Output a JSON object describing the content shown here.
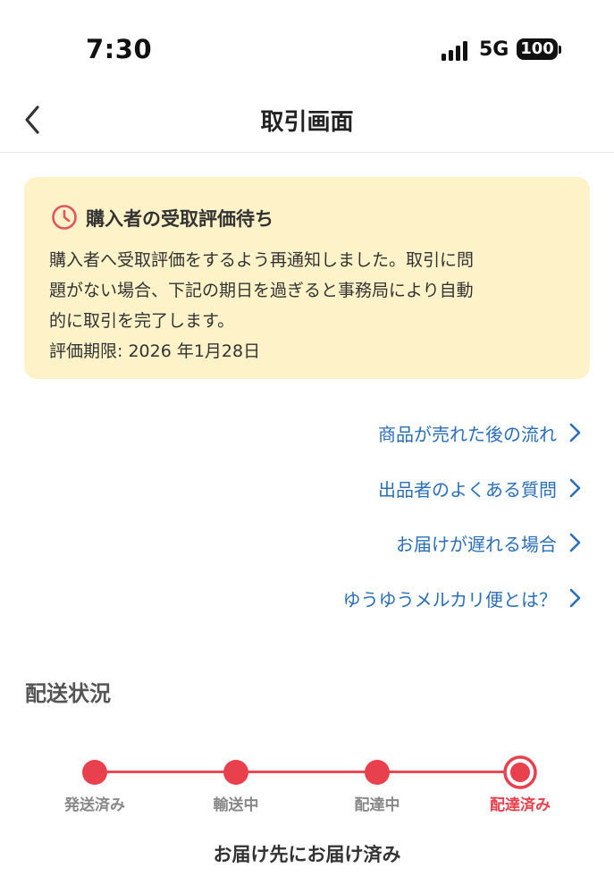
{
  "status_bar": {
    "time": "7:30",
    "network": "5G",
    "battery": "100"
  },
  "nav": {
    "title": "取引画面"
  },
  "notice": {
    "title": "購入者の受取評価待ち",
    "lines": [
      "購入者へ受取評価をするよう再通知しました。取引に問",
      "題がない場合、下記の期日を過ぎると事務局により自動",
      "的に取引を完了します。",
      "評価期限: 2026 年1月28日"
    ],
    "accent_color": "#e05561",
    "background": "#fdf2c8"
  },
  "links": [
    {
      "label": "商品が売れた後の流れ"
    },
    {
      "label": "出品者のよくある質問"
    },
    {
      "label": "お届けが遅れる場合"
    },
    {
      "label": "ゆうゆうメルカリ便とは？"
    }
  ],
  "delivery": {
    "section_title": "配送状況",
    "steps": [
      {
        "label": "発送済み",
        "state": "done"
      },
      {
        "label": "輸送中",
        "state": "done"
      },
      {
        "label": "配達中",
        "state": "done"
      },
      {
        "label": "配達済み",
        "state": "current"
      }
    ],
    "status_text": "お届け先にお届け済み",
    "accent_color": "#e8404c"
  },
  "icons": {
    "back": "chevron-left-icon",
    "clock": "clock-icon",
    "link": "chevron-right-icon"
  }
}
